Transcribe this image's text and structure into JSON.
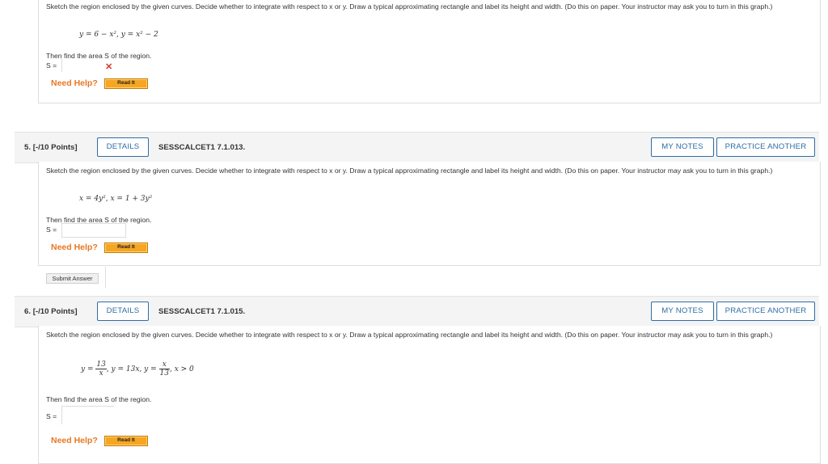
{
  "prompt_text": "Sketch the region enclosed by the given curves. Decide whether to integrate with respect to x or y. Draw a typical approximating rectangle and label its height and width. (Do this on paper. Your instructor may ask you to turn in this graph.)",
  "common": {
    "then_text": "Then find the area S of the region.",
    "s_label": "S =",
    "need_help": "Need Help?",
    "read_it": "Read It",
    "details": "DETAILS",
    "my_notes": "MY NOTES",
    "practice_another": "PRACTICE ANOTHER",
    "submit_answer": "Submit Answer"
  },
  "q4": {
    "equation": "y = 6 − x², y = x² − 2",
    "answer_value": "",
    "status_icon": "x-mark-icon"
  },
  "q5": {
    "number_label": "5.",
    "points": "[-/10 Points]",
    "code": "SESSCALCET1 7.1.013.",
    "equation": "x = 4y², x = 1 + 3y²",
    "answer_value": ""
  },
  "q6": {
    "number_label": "6.",
    "points": "[-/10 Points]",
    "code": "SESSCALCET1 7.1.015.",
    "eq_y": "y =",
    "eq_frac1_num": "13",
    "eq_frac1_den": "x",
    "eq_mid": ", y = 13x, y =",
    "eq_frac2_num": "x",
    "eq_frac2_den": "13",
    "eq_tail": ", x > 0",
    "answer_value": ""
  },
  "colors": {
    "accent_blue": "#2f6da5",
    "help_orange": "#e87722",
    "read_it_bg": "#f6a623",
    "error_red": "#d9342b",
    "header_bg": "#f4f4f4"
  }
}
